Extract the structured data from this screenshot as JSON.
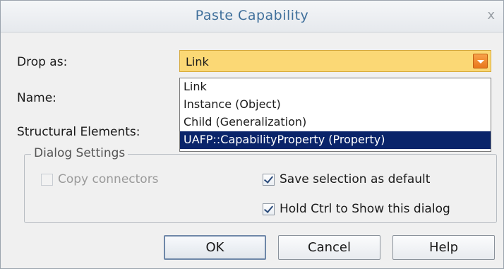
{
  "window": {
    "title": "Paste Capability",
    "close_glyph": "x"
  },
  "form": {
    "drop_as_label": "Drop as:",
    "name_label": "Name:",
    "structural_label": "Structural Elements:",
    "drop_as_value": "Link"
  },
  "dropdown": {
    "options": [
      {
        "label": "Link",
        "selected": false
      },
      {
        "label": "Instance (Object)",
        "selected": false
      },
      {
        "label": "Child (Generalization)",
        "selected": false
      },
      {
        "label": "UAFP::CapabilityProperty (Property)",
        "selected": true
      }
    ]
  },
  "dialog_settings": {
    "legend": "Dialog Settings",
    "copy_connectors": {
      "label": "Copy connectors",
      "checked": false,
      "disabled": true
    },
    "save_selection": {
      "label": "Save selection as default",
      "checked": true
    },
    "hold_ctrl": {
      "label": "Hold Ctrl to Show this dialog",
      "checked": true
    }
  },
  "buttons": {
    "ok": "OK",
    "cancel": "Cancel",
    "help": "Help"
  },
  "colors": {
    "combo_background": "#fbd875",
    "selection": "#0a246a",
    "title_text": "#3f6f9b"
  },
  "icons": {
    "close": "close-icon",
    "dropdown_arrow": "chevron-down-icon",
    "checkmark": "checkmark-icon"
  }
}
